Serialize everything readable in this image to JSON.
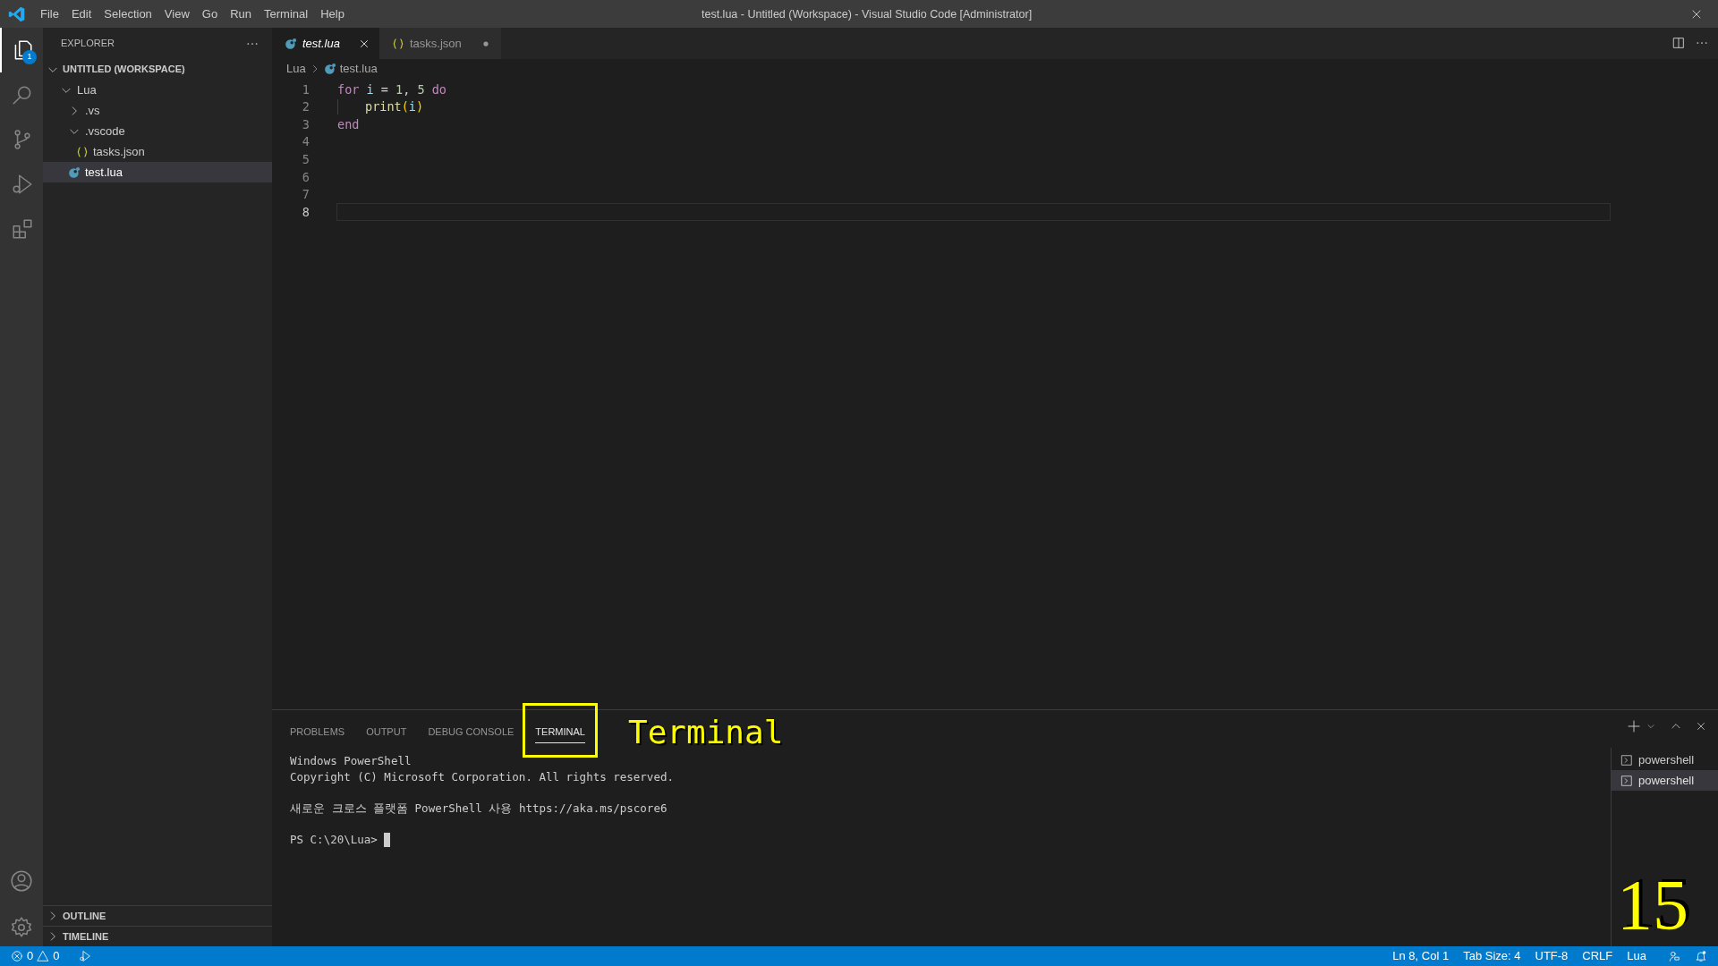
{
  "title_bar": {
    "menu": [
      "File",
      "Edit",
      "Selection",
      "View",
      "Go",
      "Run",
      "Terminal",
      "Help"
    ],
    "title": "test.lua - Untitled (Workspace) - Visual Studio Code [Administrator]"
  },
  "activity_bar": {
    "items": [
      {
        "kind": "explorer",
        "selected": true,
        "badge": "1"
      },
      {
        "kind": "search",
        "selected": false
      },
      {
        "kind": "source-control",
        "selected": false
      },
      {
        "kind": "run",
        "selected": false
      },
      {
        "kind": "extensions",
        "selected": false
      }
    ],
    "bottom": [
      {
        "kind": "account"
      },
      {
        "kind": "settings"
      }
    ]
  },
  "sidebar": {
    "title": "EXPLORER",
    "workspace": {
      "label": "UNTITLED (WORKSPACE)",
      "expanded": true
    },
    "tree": [
      {
        "label": "Lua",
        "kind": "folder",
        "expanded": true,
        "selected": false,
        "children": [
          {
            "label": ".vs",
            "kind": "folder",
            "expanded": false,
            "selected": false
          },
          {
            "label": ".vscode",
            "kind": "folder",
            "expanded": true,
            "selected": false,
            "children": [
              {
                "label": "tasks.json",
                "kind": "json",
                "selected": false
              }
            ]
          },
          {
            "label": "test.lua",
            "kind": "lua",
            "selected": true
          }
        ]
      }
    ],
    "sections": [
      {
        "label": "OUTLINE",
        "expanded": false
      },
      {
        "label": "TIMELINE",
        "expanded": false
      }
    ]
  },
  "tabs": [
    {
      "label": "test.lua",
      "kind": "lua",
      "selected": true,
      "dirty": false
    },
    {
      "label": "tasks.json",
      "kind": "json",
      "selected": false,
      "dirty": true
    }
  ],
  "breadcrumb": [
    {
      "label": "Lua",
      "kind": "folder"
    },
    {
      "label": "test.lua",
      "kind": "lua"
    }
  ],
  "editor": {
    "lines": [
      {
        "number": "1",
        "selected": false,
        "indent_guide": false,
        "tokens": [
          {
            "text": "for",
            "kind": "keyword"
          },
          {
            "text": " i",
            "kind": "variable"
          },
          {
            "text": " = ",
            "kind": "plain"
          },
          {
            "text": "1",
            "kind": "number"
          },
          {
            "text": ", ",
            "kind": "plain"
          },
          {
            "text": "5",
            "kind": "number"
          },
          {
            "text": " do",
            "kind": "keyword"
          }
        ]
      },
      {
        "number": "2",
        "selected": false,
        "indent_guide": true,
        "tokens": [
          {
            "text": "print",
            "kind": "function"
          },
          {
            "text": "(",
            "kind": "bracket"
          },
          {
            "text": "i",
            "kind": "variable"
          },
          {
            "text": ")",
            "kind": "bracket"
          }
        ]
      },
      {
        "number": "3",
        "selected": false,
        "indent_guide": false,
        "tokens": [
          {
            "text": "end",
            "kind": "keyword"
          }
        ]
      },
      {
        "number": "4",
        "selected": false,
        "indent_guide": false
      },
      {
        "number": "5",
        "selected": false,
        "indent_guide": false
      },
      {
        "number": "6",
        "selected": false,
        "indent_guide": false
      },
      {
        "number": "7",
        "selected": false,
        "indent_guide": false
      },
      {
        "number": "8",
        "selected": true,
        "indent_guide": false
      }
    ]
  },
  "panel": {
    "tabs": [
      {
        "label": "PROBLEMS",
        "selected": false,
        "highlighted": false
      },
      {
        "label": "OUTPUT",
        "selected": false,
        "highlighted": false
      },
      {
        "label": "DEBUG CONSOLE",
        "selected": false,
        "highlighted": false
      },
      {
        "label": "TERMINAL",
        "selected": true,
        "highlighted": true
      }
    ],
    "callout": "Terminal",
    "terminal": {
      "blocks": [
        [
          "Windows PowerShell",
          "Copyright (C) Microsoft Corporation. All rights reserved."
        ],
        [
          "새로운 크로스 플랫폼 PowerShell 사용 https://aka.ms/pscore6"
        ]
      ],
      "prompt": "PS C:\\20\\Lua>",
      "cursor": true
    },
    "terminals": [
      {
        "label": "powershell",
        "selected": false
      },
      {
        "label": "powershell",
        "selected": true
      }
    ]
  },
  "page_number": "15",
  "status_bar": {
    "errors": "0",
    "warnings": "0",
    "items": [
      "Ln 8, Col 1",
      "Tab Size: 4",
      "UTF-8",
      "CRLF",
      "Lua"
    ]
  }
}
